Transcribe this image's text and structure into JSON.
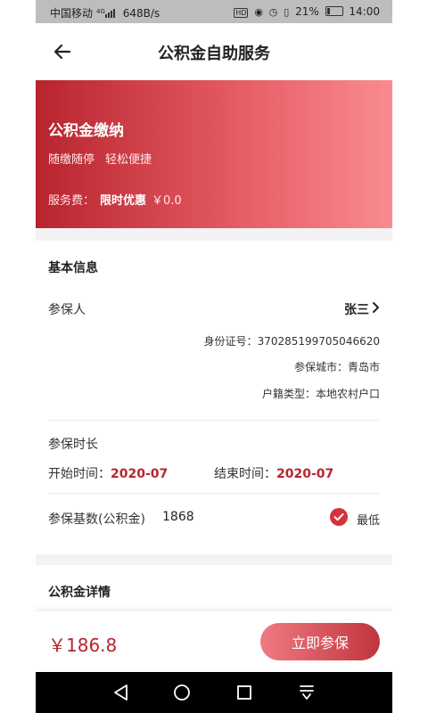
{
  "status_bar": {
    "carrier": "中国移动",
    "network": "4G",
    "speed": "648B/s",
    "hd": "HD",
    "battery": "21%",
    "battery_level": 0.21,
    "time": "14:00"
  },
  "header": {
    "title": "公积金自助服务"
  },
  "hero": {
    "title": "公积金缴纳",
    "tags": [
      "随缴随停",
      "轻松便捷"
    ],
    "fee_label": "服务费：",
    "fee_promo": "限时优惠",
    "fee_value": "￥0.0"
  },
  "basic_info": {
    "title": "基本信息",
    "insured_label": "参保人",
    "insured_name": "张三",
    "id_label": "身份证号：",
    "id_value": "370285199705046620",
    "city_label": "参保城市：",
    "city_value": "青岛市",
    "household_label": "户籍类型：",
    "household_value": "本地农村户口",
    "duration_label": "参保时长",
    "start_label": "开始时间：",
    "start_value": "2020-07",
    "end_label": "结束时间：",
    "end_value": "2020-07",
    "base_label": "参保基数(公积金)",
    "base_value": "1868",
    "lowest_label": "最低",
    "lowest_checked": true
  },
  "details": {
    "title": "公积金详情"
  },
  "bottom_bar": {
    "price": "￥186.8",
    "cta_label": "立即参保"
  },
  "colors": {
    "accent": "#b8242e",
    "hero_start": "#b8242e",
    "hero_end": "#f98b90",
    "check": "#d5323c"
  },
  "icons": {
    "back": "arrow-left-icon",
    "chevron": "chevron-right-icon",
    "check": "check-circle-icon",
    "nav_back": "triangle-back-icon",
    "nav_home": "circle-home-icon",
    "nav_recent": "square-recent-icon",
    "nav_menu": "menu-down-icon"
  }
}
